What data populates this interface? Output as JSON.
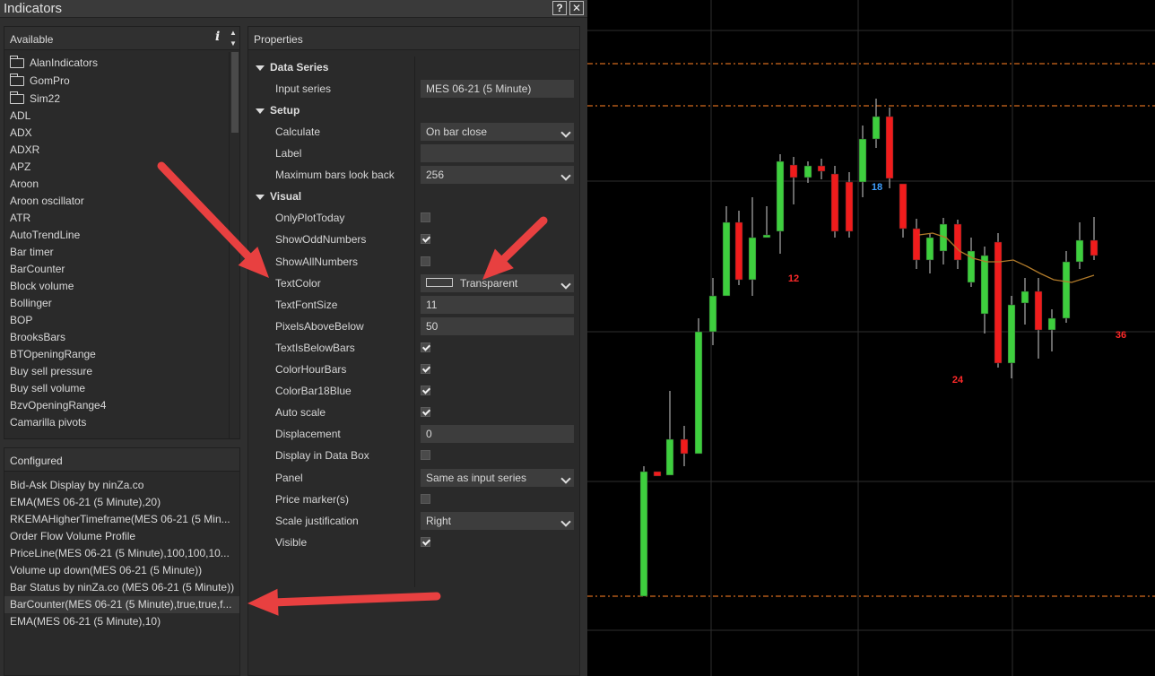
{
  "window": {
    "title": "Indicators",
    "help_label": "?",
    "close_label": "✕"
  },
  "available": {
    "header": "Available",
    "info_icon_label": "i",
    "folders": [
      "AlanIndicators",
      "GomPro",
      "Sim22"
    ],
    "items": [
      "ADL",
      "ADX",
      "ADXR",
      "APZ",
      "Aroon",
      "Aroon oscillator",
      "ATR",
      "AutoTrendLine",
      "Bar timer",
      "BarCounter",
      "Block volume",
      "Bollinger",
      "BOP",
      "BrooksBars",
      "BTOpeningRange",
      "Buy sell pressure",
      "Buy sell volume",
      "BzvOpeningRange4",
      "Camarilla pivots"
    ]
  },
  "configured": {
    "header": "Configured",
    "items": [
      "Bid-Ask Display by ninZa.co",
      "EMA(MES 06-21 (5 Minute),20)",
      "RKEMAHigherTimeframe(MES 06-21 (5 Min...",
      "Order Flow Volume Profile",
      "PriceLine(MES 06-21 (5 Minute),100,100,10...",
      "Volume up down(MES 06-21 (5 Minute))",
      "Bar Status by ninZa.co (MES 06-21 (5 Minute))",
      "BarCounter(MES 06-21 (5 Minute),true,true,f...",
      "EMA(MES 06-21 (5 Minute),10)"
    ],
    "selected_index": 7
  },
  "properties": {
    "header": "Properties",
    "rows": [
      {
        "kind": "section",
        "label": "Data Series"
      },
      {
        "kind": "text",
        "label": "Input series",
        "value": "MES 06-21 (5 Minute)"
      },
      {
        "kind": "section",
        "label": "Setup"
      },
      {
        "kind": "dropdown",
        "label": "Calculate",
        "value": "On bar close"
      },
      {
        "kind": "text",
        "label": "Label",
        "value": ""
      },
      {
        "kind": "dropdown",
        "label": "Maximum bars look back",
        "value": "256"
      },
      {
        "kind": "section",
        "label": "Visual"
      },
      {
        "kind": "check",
        "label": "OnlyPlotToday",
        "checked": false
      },
      {
        "kind": "check",
        "label": "ShowOddNumbers",
        "checked": true
      },
      {
        "kind": "check",
        "label": "ShowAllNumbers",
        "checked": false
      },
      {
        "kind": "color",
        "label": "TextColor",
        "value": "Transparent"
      },
      {
        "kind": "text",
        "label": "TextFontSize",
        "value": "11"
      },
      {
        "kind": "text",
        "label": "PixelsAboveBelow",
        "value": "50"
      },
      {
        "kind": "check",
        "label": "TextIsBelowBars",
        "checked": true
      },
      {
        "kind": "check",
        "label": "ColorHourBars",
        "checked": true
      },
      {
        "kind": "check",
        "label": "ColorBar18Blue",
        "checked": true
      },
      {
        "kind": "check",
        "label": "Auto scale",
        "checked": true
      },
      {
        "kind": "text",
        "label": "Displacement",
        "value": "0"
      },
      {
        "kind": "check",
        "label": "Display in Data Box",
        "checked": false
      },
      {
        "kind": "dropdown",
        "label": "Panel",
        "value": "Same as input series"
      },
      {
        "kind": "check",
        "label": "Price marker(s)",
        "checked": false
      },
      {
        "kind": "dropdown",
        "label": "Scale justification",
        "value": "Right"
      },
      {
        "kind": "check",
        "label": "Visible",
        "checked": true
      }
    ]
  },
  "chart": {
    "bar_labels": [
      {
        "text": "12",
        "color": "#ff2a2a"
      },
      {
        "text": "18",
        "color": "#3fa0ff"
      },
      {
        "text": "24",
        "color": "#ff2a2a"
      },
      {
        "text": "36",
        "color": "#ff2a2a"
      }
    ],
    "colors": {
      "up": "#3ecf3e",
      "down": "#f01c1c",
      "ema": "#b07a2a",
      "level": "#d2691e",
      "grid": "#2e2e2e"
    }
  },
  "colors": {
    "annotation_arrow": "#e84040"
  }
}
